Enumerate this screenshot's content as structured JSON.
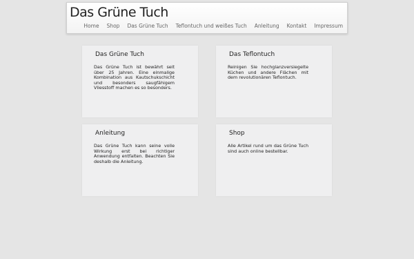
{
  "header": {
    "logo": "Das Grüne Tuch",
    "nav": [
      "Home",
      "Shop",
      "Das Grüne Tuch",
      "Teflontuch und weißes Tuch",
      "Anleitung",
      "Kontakt",
      "Impressum"
    ]
  },
  "boxes": [
    {
      "title": "Das Grüne Tuch",
      "text": "Das Grüne Tuch ist bewährt seit über 25 Jahren. Eine einmalige Kombination aus Kautschukschicht und besonders saugfähigem Vliesstoff machen es so besonders."
    },
    {
      "title": "Das Teflontuch",
      "text": "Reinigen Sie hochglanzversiegelte Küchen und andere Flächen mit dem revolutionären Teflontuch."
    },
    {
      "title": "Anleitung",
      "text": "Das Grüne Tuch kann seine volle Wirkung erst bei richtiger Anwendung entfalten. Beachten Sie deshalb die Anleitung."
    },
    {
      "title": "Shop",
      "text": "Alle Artikel rund um das Grüne Tuch sind auch online bestellbar."
    }
  ]
}
